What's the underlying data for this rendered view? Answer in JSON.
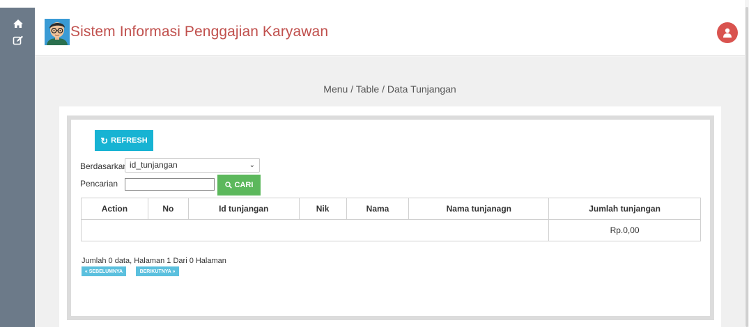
{
  "colors": {
    "sidebar": "#6c7a89",
    "title": "#c0504d",
    "user_button": "#d9534f",
    "refresh_button": "#17b3d3",
    "search_button": "#5cb85c",
    "pager_button": "#5bc0de"
  },
  "sidebar": {
    "items": [
      {
        "icon": "home-icon"
      },
      {
        "icon": "edit-icon"
      }
    ]
  },
  "header": {
    "title": "Sistem Informasi Penggajian Karyawan",
    "logo_icon": "avatar-logo-icon",
    "user_icon": "user-icon"
  },
  "breadcrumb": "Menu / Table / Data Tunjangan",
  "toolbar": {
    "refresh_label": "REFRESH",
    "refresh_icon": "refresh-icon"
  },
  "filter": {
    "by_label": "Berdasarkan:",
    "by_value": "id_tunjangan",
    "search_label": "Pencarian   :",
    "search_value": "",
    "search_button": "CARI",
    "search_icon": "search-icon"
  },
  "table": {
    "headers": [
      "Action",
      "No",
      "Id tunjangan",
      "Nik",
      "Nama",
      "Nama tunjanagn",
      "Jumlah tunjangan"
    ],
    "total": "Rp.0,00"
  },
  "pagination": {
    "info": "Jumlah 0 data, Halaman 1 Dari 0 Halaman",
    "prev": "« SEBELUMNYA",
    "next": "BERIKUTNYA »"
  }
}
